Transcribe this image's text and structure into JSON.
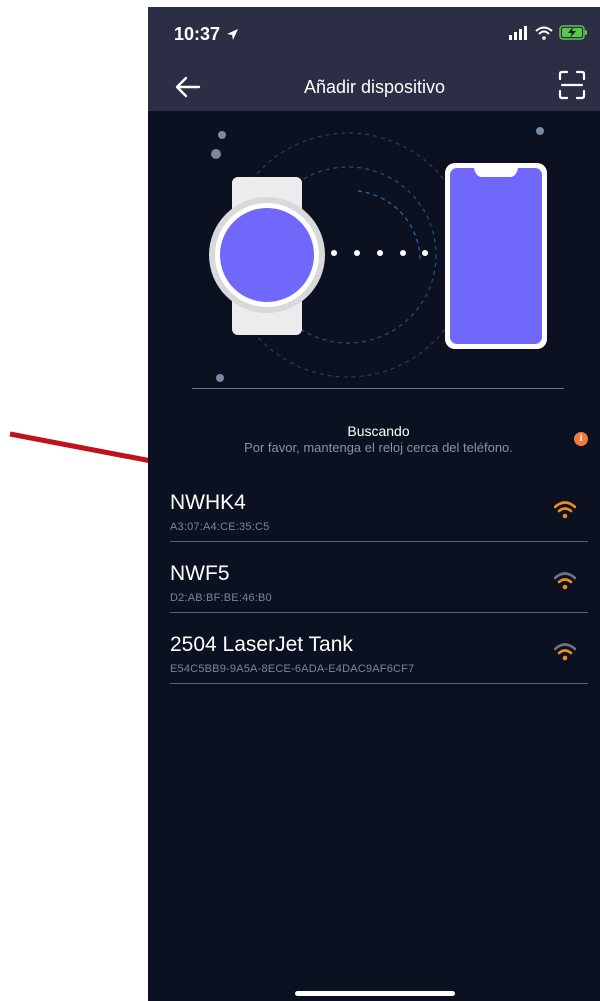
{
  "status_bar": {
    "time": "10:37"
  },
  "nav": {
    "title": "Añadir dispositivo",
    "back_icon": "arrow-left-icon",
    "scan_icon": "scan-frame-icon"
  },
  "search": {
    "title": "Buscando",
    "subtitle": "Por favor, mantenga el reloj cerca del teléfono.",
    "info_glyph": "i"
  },
  "devices": [
    {
      "name": "NWHK4",
      "address": "A3:07:A4:CE:35:C5",
      "signal": "strong"
    },
    {
      "name": "NWF5",
      "address": "D2:AB:BF:BE:46:B0",
      "signal": "medium"
    },
    {
      "name": "2504 LaserJet Tank",
      "address": "E54C5BB9-9A5A-8ECE-6ADA-E4DAC9AF6CF7",
      "signal": "medium"
    }
  ],
  "colors": {
    "nav_bg": "#2b2e44",
    "screen_bg": "#0b1120",
    "accent_orange": "#f08a24",
    "device_purple": "#7067fb",
    "annotation_red": "#c0121c"
  }
}
